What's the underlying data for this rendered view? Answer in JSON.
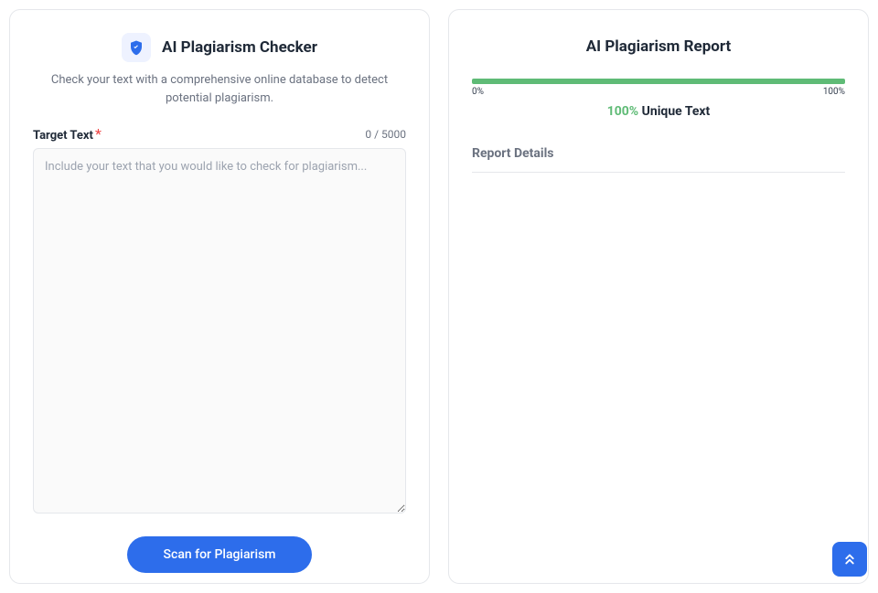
{
  "checker": {
    "title": "AI Plagiarism Checker",
    "subtitle": "Check your text with a comprehensive online database to detect potential plagiarism.",
    "label": "Target Text",
    "char_count": "0 / 5000",
    "placeholder": "Include your text that you would like to check for plagiarism...",
    "button": "Scan for Plagiarism"
  },
  "report": {
    "title": "AI Plagiarism Report",
    "range_min": "0%",
    "range_max": "100%",
    "result_percent": "100%",
    "result_label": " Unique Text",
    "details_heading": "Report Details"
  }
}
